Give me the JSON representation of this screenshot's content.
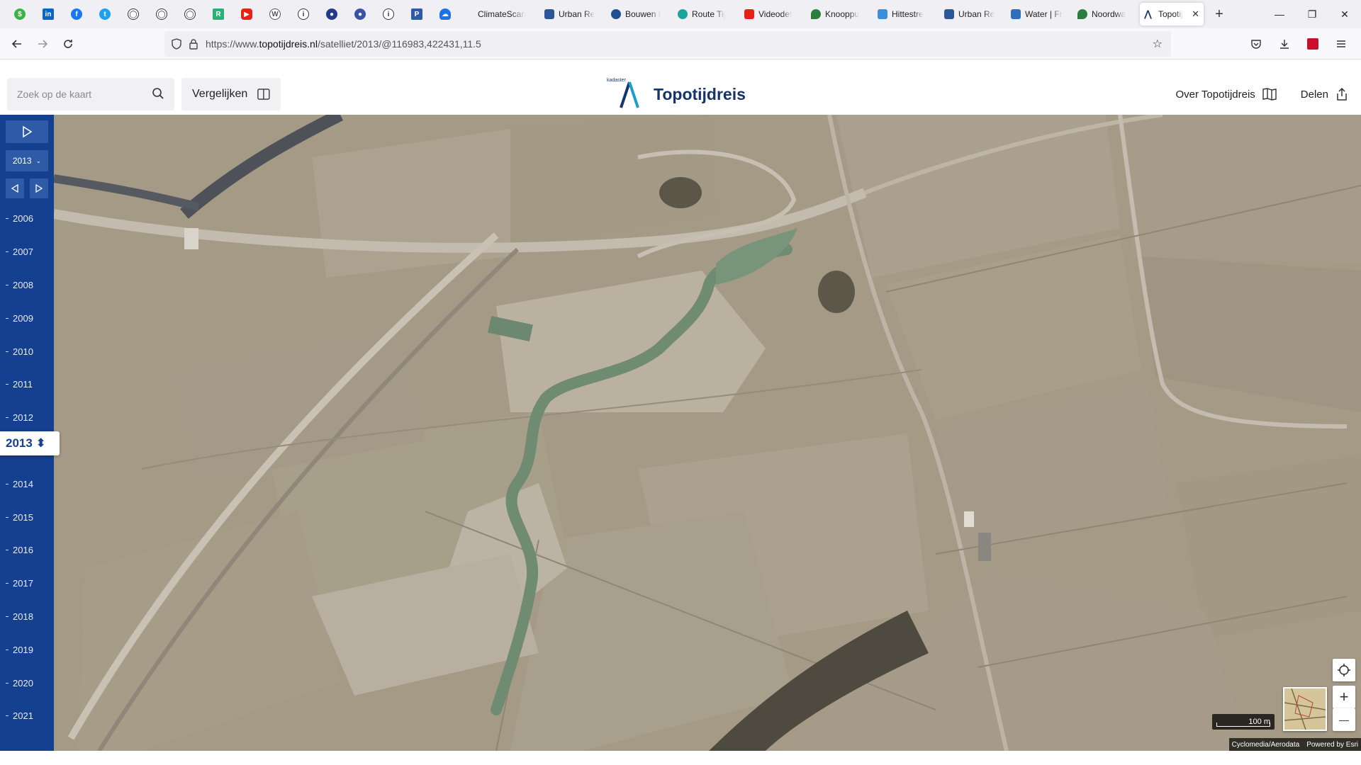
{
  "browser": {
    "tabs": [
      {
        "label": "ClimateScan",
        "color": "#ffffff"
      },
      {
        "label": "Urban Re",
        "color": "#2b579a"
      },
      {
        "label": "Bouwen t",
        "color": "#1d4f91"
      },
      {
        "label": "Route Tij",
        "color": "#1aa39b"
      },
      {
        "label": "Videodet",
        "color": "#e62117"
      },
      {
        "label": "Knooppu",
        "color": "#2a7f3f"
      },
      {
        "label": "Hittestre",
        "color": "#3b8fd8"
      },
      {
        "label": "Urban Re",
        "color": "#2b579a"
      },
      {
        "label": "Water | Fr",
        "color": "#2f6ebd"
      },
      {
        "label": "Noordwa",
        "color": "#2a7f3f"
      }
    ],
    "active_tab": {
      "label": "Topotij",
      "close": "✕"
    },
    "new_tab": "+",
    "url_prefix": "https://www.",
    "url_host": "topotijdreis.nl",
    "url_path": "/satelliet/2013/@116983,422431,11.5",
    "window_controls": [
      "—",
      "❐",
      "✕"
    ]
  },
  "app": {
    "search_placeholder": "Zoek op de kaart",
    "compare_label": "Vergelijken",
    "brand_kadaster": "kadaster",
    "brand_name": "Topotijdreis",
    "about_label": "Over Topotijdreis",
    "share_label": "Delen"
  },
  "timeline": {
    "selected_year": "2013",
    "current_year_label": "2013 ⬍",
    "years": [
      "2006",
      "2007",
      "2008",
      "2009",
      "2010",
      "2011",
      "2012",
      "2013",
      "2014",
      "2015",
      "2016",
      "2017",
      "2018",
      "2019",
      "2020",
      "2021"
    ]
  },
  "map": {
    "scale_label": "100 m",
    "attribution_left": "Cyclomedia/Aerodata",
    "attribution_right": "Powered by Esri",
    "zoom_in": "+",
    "zoom_out": "—"
  }
}
